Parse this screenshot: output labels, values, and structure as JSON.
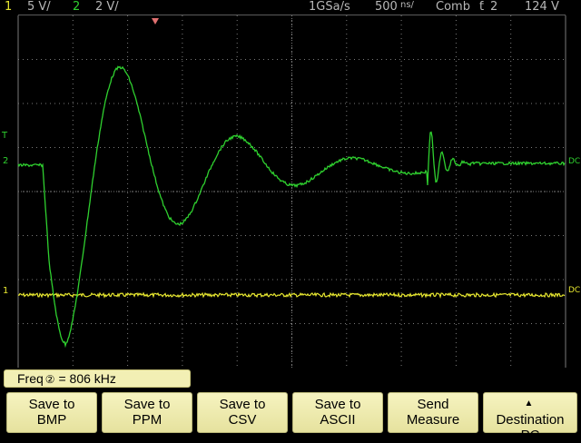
{
  "status_bar": {
    "ch1_num": "1",
    "ch1_scale": "5 V/",
    "ch2_num": "2",
    "ch2_scale": "2 V/",
    "sample_rate": "1GSa/s",
    "timebase": "500",
    "acq_mode": "Comb",
    "trigger_source": "2",
    "trigger_level": "124 V"
  },
  "markers": {
    "left_t": "T",
    "left_ch2": "2",
    "left_ch1": "1",
    "right_ch2": "DC",
    "right_ch1": "DC"
  },
  "measurement": {
    "label": "Freq",
    "channel_glyph": "②",
    "eq": "=",
    "value": "806 kHz"
  },
  "softkeys": [
    {
      "line1": "Save to",
      "line2": "BMP"
    },
    {
      "line1": "Save to",
      "line2": "PPM"
    },
    {
      "line1": "Save to",
      "line2": "CSV"
    },
    {
      "line1": "Save to",
      "line2": "ASCII"
    },
    {
      "line1": "Send",
      "line2": "Measure"
    },
    {
      "line1": "Destination",
      "line2": "PC"
    }
  ],
  "colors": {
    "ch1": "#e8e830",
    "ch2": "#2fd02f",
    "grid": "#7a7a7a",
    "background": "#000000"
  },
  "waveform": {
    "ch2_description": "damped ringing after negative step",
    "ch1_description": "flat noisy trace"
  }
}
